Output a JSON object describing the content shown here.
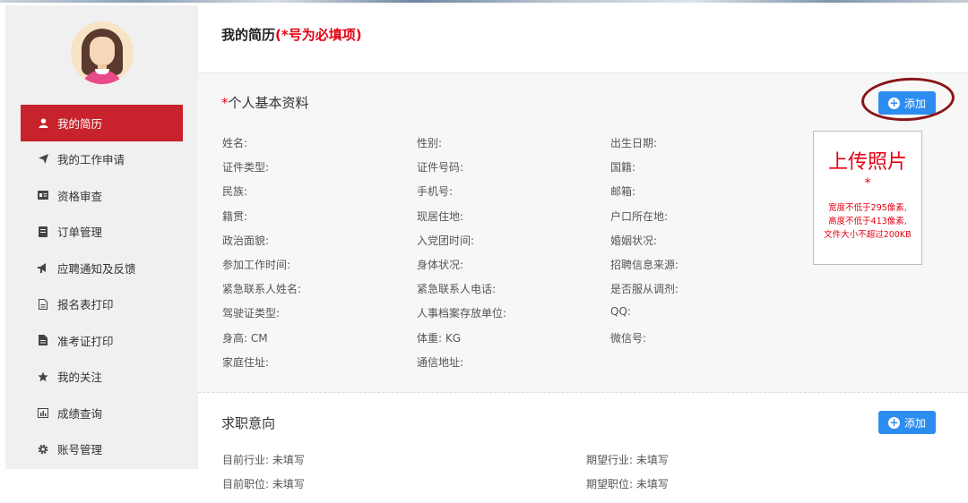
{
  "sidebar": {
    "items": [
      {
        "label": "我的简历",
        "icon": "user-icon",
        "active": true
      },
      {
        "label": "我的工作申请",
        "icon": "paper-plane-icon"
      },
      {
        "label": "资格审查",
        "icon": "id-card-icon"
      },
      {
        "label": "订单管理",
        "icon": "document-icon"
      },
      {
        "label": "应聘通知及反馈",
        "icon": "bullhorn-icon"
      },
      {
        "label": "报名表打印",
        "icon": "file-icon"
      },
      {
        "label": "准考证打印",
        "icon": "file-solid-icon"
      },
      {
        "label": "我的关注",
        "icon": "star-icon"
      },
      {
        "label": "成绩查询",
        "icon": "bar-chart-icon"
      },
      {
        "label": "账号管理",
        "icon": "gear-icon"
      }
    ]
  },
  "header": {
    "title": "我的简历",
    "required_note": "(*号为必填项)"
  },
  "basic_info": {
    "star": "*",
    "title": "个人基本资料",
    "add_label": "添加",
    "col1": [
      "姓名:",
      "证件类型:",
      "民族:",
      "籍贯:",
      "政治面貌:",
      "参加工作时间:",
      "紧急联系人姓名:",
      "驾驶证类型:",
      "身高:   CM",
      "家庭住址:"
    ],
    "col2": [
      "性别:",
      "证件号码:",
      "手机号:",
      "现居住地:",
      "入党团时间:",
      "身体状况:",
      "紧急联系人电话:",
      "人事档案存放单位:",
      "体重:   KG",
      "通信地址:"
    ],
    "col3": [
      "出生日期:",
      "国籍:",
      "邮箱:",
      "户口所在地:",
      "婚姻状况:",
      "招聘信息来源:",
      "是否服从调剂:",
      "QQ:",
      "微信号:"
    ]
  },
  "photo": {
    "title": "上传照片",
    "star": "*",
    "notes": [
      "宽度不低于295像素,",
      "高度不低于413像素,",
      "文件大小不超过200KB"
    ]
  },
  "intention": {
    "title": "求职意向",
    "add_label": "添加",
    "left": [
      "目前行业:  未填写",
      "目前职位:  未填写"
    ],
    "right": [
      "期望行业:  未填写",
      "期望职位:  未填写"
    ]
  },
  "colors": {
    "accent_red": "#c8232c",
    "button_blue": "#2d8cf0",
    "required_red": "#e60012"
  }
}
